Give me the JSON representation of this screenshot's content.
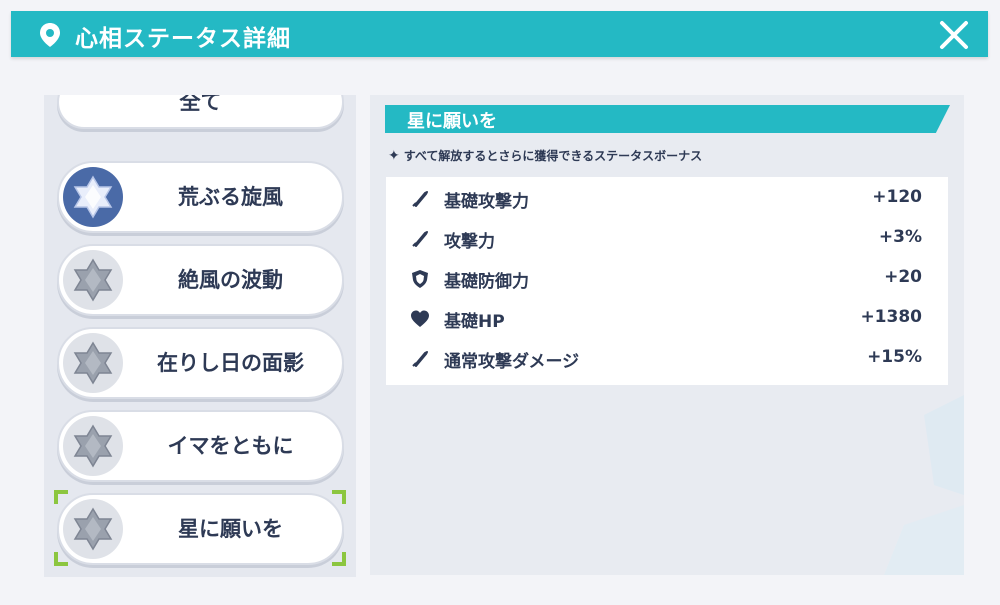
{
  "header": {
    "title": "心相ステータス詳細",
    "pin_icon": "location-pin-icon",
    "close_icon": "close-icon"
  },
  "sidebar": {
    "items": [
      {
        "label": "全て",
        "badge": "none"
      },
      {
        "label": "荒ぶる旋風",
        "badge": "crystal-active"
      },
      {
        "label": "絶風の波動",
        "badge": "crystal-inactive"
      },
      {
        "label": "在りし日の面影",
        "badge": "crystal-inactive"
      },
      {
        "label": "イマをともに",
        "badge": "crystal-inactive"
      },
      {
        "label": "星に願いを",
        "badge": "crystal-inactive",
        "selected": true
      }
    ]
  },
  "detail": {
    "section_title": "星に願いを",
    "note": "すべて解放するとさらに獲得できるステータスボーナス",
    "stats": [
      {
        "icon": "sword-icon",
        "name": "基礎攻撃力",
        "value": "+120"
      },
      {
        "icon": "sword-icon",
        "name": "攻撃力",
        "value": "+3%"
      },
      {
        "icon": "shield-icon",
        "name": "基礎防御力",
        "value": "+20"
      },
      {
        "icon": "heart-icon",
        "name": "基礎HP",
        "value": "+1380"
      },
      {
        "icon": "sword-icon",
        "name": "通常攻撃ダメージ",
        "value": "+15%"
      }
    ]
  },
  "colors": {
    "accent": "#24b9c4",
    "text": "#2e3a55",
    "selection_corner": "#8cc63f",
    "active_badge": "#4a6aa7"
  }
}
